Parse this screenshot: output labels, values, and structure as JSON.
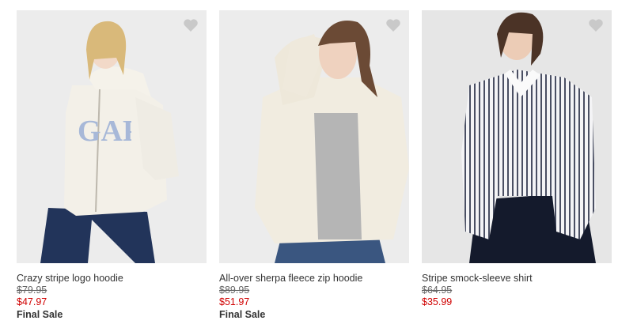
{
  "products": [
    {
      "name": "Crazy stripe logo hoodie",
      "original_price": "$79.95",
      "sale_price": "$47.97",
      "badge": "Final Sale",
      "logo_text": "GAP"
    },
    {
      "name": "All-over sherpa fleece zip hoodie",
      "original_price": "$89.95",
      "sale_price": "$51.97",
      "badge": "Final Sale"
    },
    {
      "name": "Stripe smock-sleeve shirt",
      "original_price": "$64.95",
      "sale_price": "$35.99",
      "badge": ""
    }
  ],
  "icons": {
    "favorite": "heart-icon"
  },
  "colors": {
    "sale_price": "#d00000",
    "favorite_icon": "#c9c9c9"
  }
}
